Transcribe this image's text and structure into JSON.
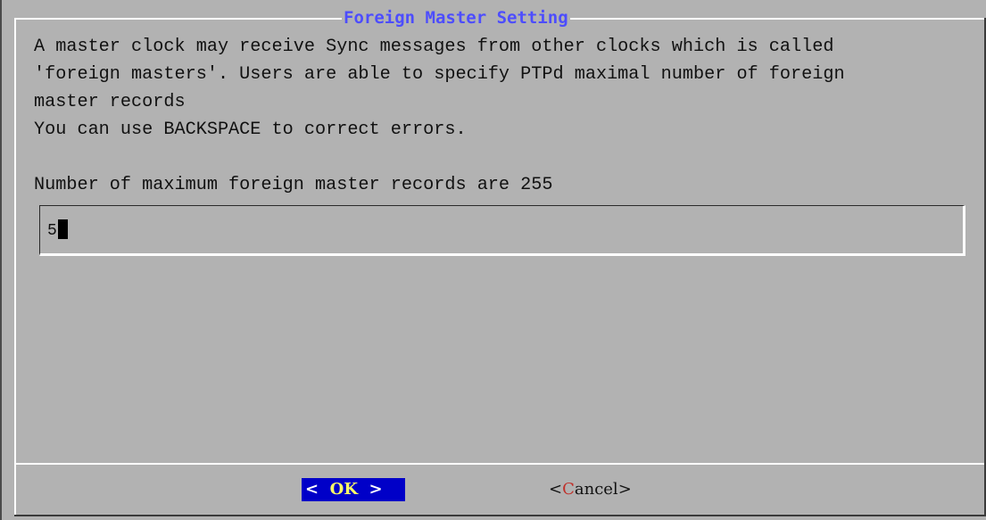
{
  "dialog": {
    "title": "Foreign Master Setting",
    "body_lines": [
      "A master clock may receive Sync messages from other clocks which is called",
      "'foreign masters'. Users are able to specify PTPd maximal number of foreign",
      "master records",
      "You can use BACKSPACE to correct errors.",
      "",
      "Number of maximum foreign master records are 255"
    ],
    "input": {
      "value": "5"
    },
    "buttons": {
      "ok": {
        "open": "<",
        "hotkey": "O",
        "rest": "K",
        "close": ">"
      },
      "cancel": {
        "open": "<",
        "hotkey": "C",
        "rest": "ancel",
        "close": ">"
      }
    }
  },
  "colors": {
    "background": "#b2b2b2",
    "title": "#4d4dff",
    "ok_bg": "#0000c8",
    "hotkey_selected": "#ffff66",
    "hotkey_unselected": "#c0302a"
  }
}
